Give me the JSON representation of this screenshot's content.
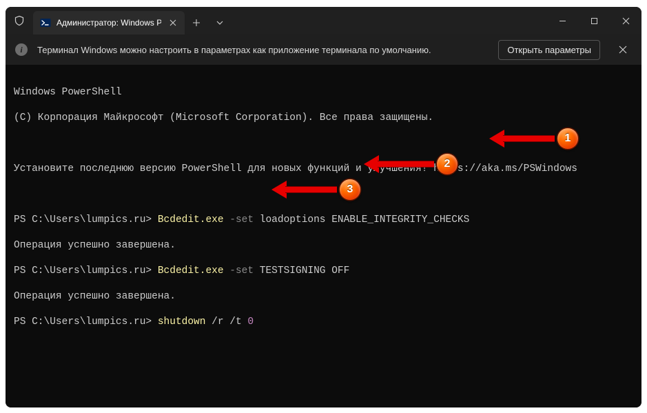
{
  "titlebar": {
    "tab_title": "Администратор: Windows Pc"
  },
  "infobar": {
    "icon_char": "i",
    "message": "Терминал Windows можно настроить в параметрах как приложение терминала по умолчанию.",
    "action_label": "Открыть параметры"
  },
  "terminal": {
    "header1": "Windows PowerShell",
    "header2": "(C) Корпорация Майкрософт (Microsoft Corporation). Все права защищены.",
    "banner_msg": "Установите последнюю версию PowerShell для новых функций и улучшения! ",
    "banner_url": "https://aka.ms/PSWindows",
    "prompt": "PS C:\\Users\\lumpics.ru> ",
    "cmd1_exe": "Bcdedit.exe",
    "cmd1_flag": " -set ",
    "cmd1_args": "loadoptions ENABLE_INTEGRITY_CHECKS",
    "result_ok": "Операция успешно завершена.",
    "cmd2_exe": "Bcdedit.exe",
    "cmd2_flag": " -set ",
    "cmd2_args": "TESTSIGNING OFF",
    "cmd3_exe": "shutdown",
    "cmd3_args": " /r /t ",
    "cmd3_num": "0"
  },
  "annotations": {
    "badge1": "1",
    "badge2": "2",
    "badge3": "3"
  }
}
